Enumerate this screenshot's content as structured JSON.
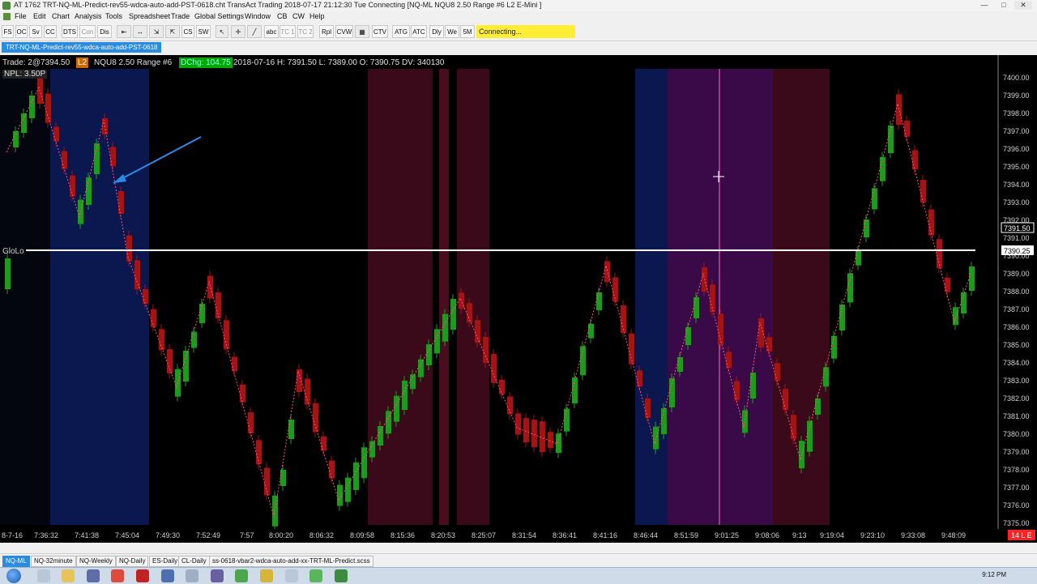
{
  "window": {
    "title": "AT 1762 TRT-NQ-ML-Predict-rev55-wdca-auto-add-PST-0618.cht  TransAct Trading 2018-07-17  21:12:30 Tue  Connecting  [NQ-ML  NQU8  2.50 Range  #6  L2  E-Mini ]",
    "min": "—",
    "max": "□",
    "close": "✕"
  },
  "menu": [
    "File",
    "Edit",
    "Chart",
    "Analysis",
    "Tools",
    "Spreadsheet",
    "Trade",
    "Global Settings",
    "Window",
    "CB",
    "CW",
    "Help"
  ],
  "toolbar": {
    "buttons": [
      "FS",
      "OC",
      "Sv",
      "CC",
      "DTS",
      "Con",
      "Dis",
      "CS",
      "SW",
      "abc",
      "TC 1",
      "TC 2",
      "Rpl",
      "CVW",
      "CTV",
      "ATG",
      "ATC",
      "Dly",
      "We",
      "5M"
    ],
    "status": "Connecting..."
  },
  "chart_tab": "TRT-NQ-ML-Predict-rev55-wdca-auto-add-PST-0618",
  "chart": {
    "trade": "Trade: 2@7394.50",
    "l2": "L2",
    "symbol": "NQU8 2.50 Range #6",
    "dchg": "DChg: 104.75",
    "ohlc": "2018-07-16 H: 7391.50 L: 7389.00 O: 7390.75 DV: 340130",
    "npl": "NPL: 3.50P",
    "glolo_label": "GloLo",
    "price_labels": [
      "7400.00",
      "7399.00",
      "7398.00",
      "7397.00",
      "7396.00",
      "7395.00",
      "7394.00",
      "7393.00",
      "7392.00",
      "7391.00",
      "7390.00",
      "7389.00",
      "7388.00",
      "7387.00",
      "7386.00",
      "7385.00",
      "7384.00",
      "7383.00",
      "7382.00",
      "7381.00",
      "7380.00",
      "7379.00",
      "7378.00",
      "7377.00",
      "7376.00",
      "7375.00"
    ],
    "current_price_1": "7391.50",
    "current_price_2": "7390.25",
    "time_labels": [
      "8-7-16",
      "7:36:32",
      "7:41:38",
      "7:45:04",
      "7:49:30",
      "7:52:49",
      "7:57",
      "8:00:20",
      "8:06:32",
      "8:09:58",
      "8:15:36",
      "8:20:53",
      "8:25:07",
      "8:31:54",
      "8:36:41",
      "8:41:16",
      "8:46:44",
      "8:51:59",
      "9:01:25",
      "9:08:06",
      "9:13",
      "9:19:04",
      "9:23:10",
      "9:33:08",
      "9:48:09"
    ],
    "last_badge": "14 L E",
    "colors": {
      "up": "#1f9a1f",
      "up_blue": "#2d7fd6",
      "down": "#a01515",
      "down_pink": "#ff9ccc",
      "zigzag": "#ff4d88",
      "glolo": "#ffffff",
      "shade_blue": "#0c1a4a",
      "shade_red": "#3a0a1a",
      "shade_purple": "#3a0a48",
      "cursor": "#ff66cc",
      "arrow": "#2d8ae8"
    }
  },
  "bottom_tabs": [
    "NQ-ML",
    "NQ-32minute",
    "NQ-Weekly",
    "NQ-Daily",
    "ES-Daily",
    "CL-Daily",
    "ss-0618-vbar2-wdca-auto-add-xx-TRT-ML-Predict.scss"
  ],
  "taskbar": {
    "clock": "9:12 PM"
  }
}
